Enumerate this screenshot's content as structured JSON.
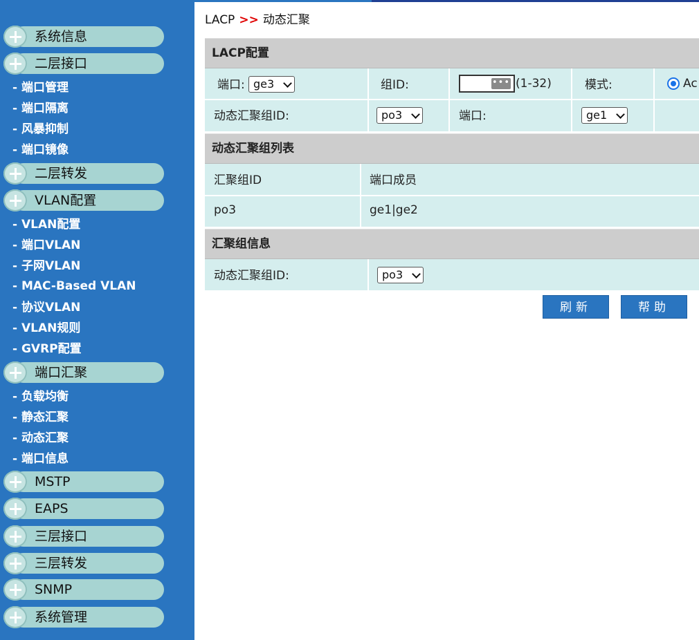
{
  "sidebar": {
    "groups": [
      {
        "label": "系统信息"
      },
      {
        "label": "二层接口"
      },
      {
        "label": "二层转发"
      },
      {
        "label": "VLAN配置"
      },
      {
        "label": "端口汇聚"
      },
      {
        "label": "MSTP"
      },
      {
        "label": "EAPS"
      },
      {
        "label": "三层接口"
      },
      {
        "label": "三层转发"
      },
      {
        "label": "SNMP"
      },
      {
        "label": "系统管理"
      }
    ],
    "l2_items": [
      "- 端口管理",
      "- 端口隔离",
      "- 风暴抑制",
      "- 端口镜像"
    ],
    "vlan_items": [
      "- VLAN配置",
      "- 端口VLAN",
      "- 子网VLAN",
      "- MAC-Based VLAN",
      "- 协议VLAN",
      "- VLAN规则",
      "- GVRP配置"
    ],
    "agg_items": [
      "- 负载均衡",
      "- 静态汇聚",
      "- 动态汇聚",
      "- 端口信息"
    ]
  },
  "breadcrumb": {
    "root": "LACP",
    "sep": ">>",
    "current": "动态汇聚"
  },
  "lacp_config": {
    "title": "LACP配置",
    "port_label": "端口:",
    "port_value": "ge3",
    "group_id_label": "组ID:",
    "group_id_value": "",
    "group_id_dots": "•••",
    "group_id_range": "(1-32)",
    "mode_label": "模式:",
    "mode_value": "Ac",
    "dyn_group_label": "动态汇聚组ID:",
    "dyn_group_value": "po3",
    "port2_label": "端口:",
    "port2_value": "ge1"
  },
  "group_list": {
    "title": "动态汇聚组列表",
    "headers": [
      "汇聚组ID",
      "端口成员"
    ],
    "rows": [
      [
        "po3",
        "ge1|ge2"
      ]
    ]
  },
  "group_info": {
    "title": "汇聚组信息",
    "dyn_group_label": "动态汇聚组ID:",
    "dyn_group_value": "po3"
  },
  "buttons": {
    "refresh": "刷新",
    "help": "帮助"
  }
}
